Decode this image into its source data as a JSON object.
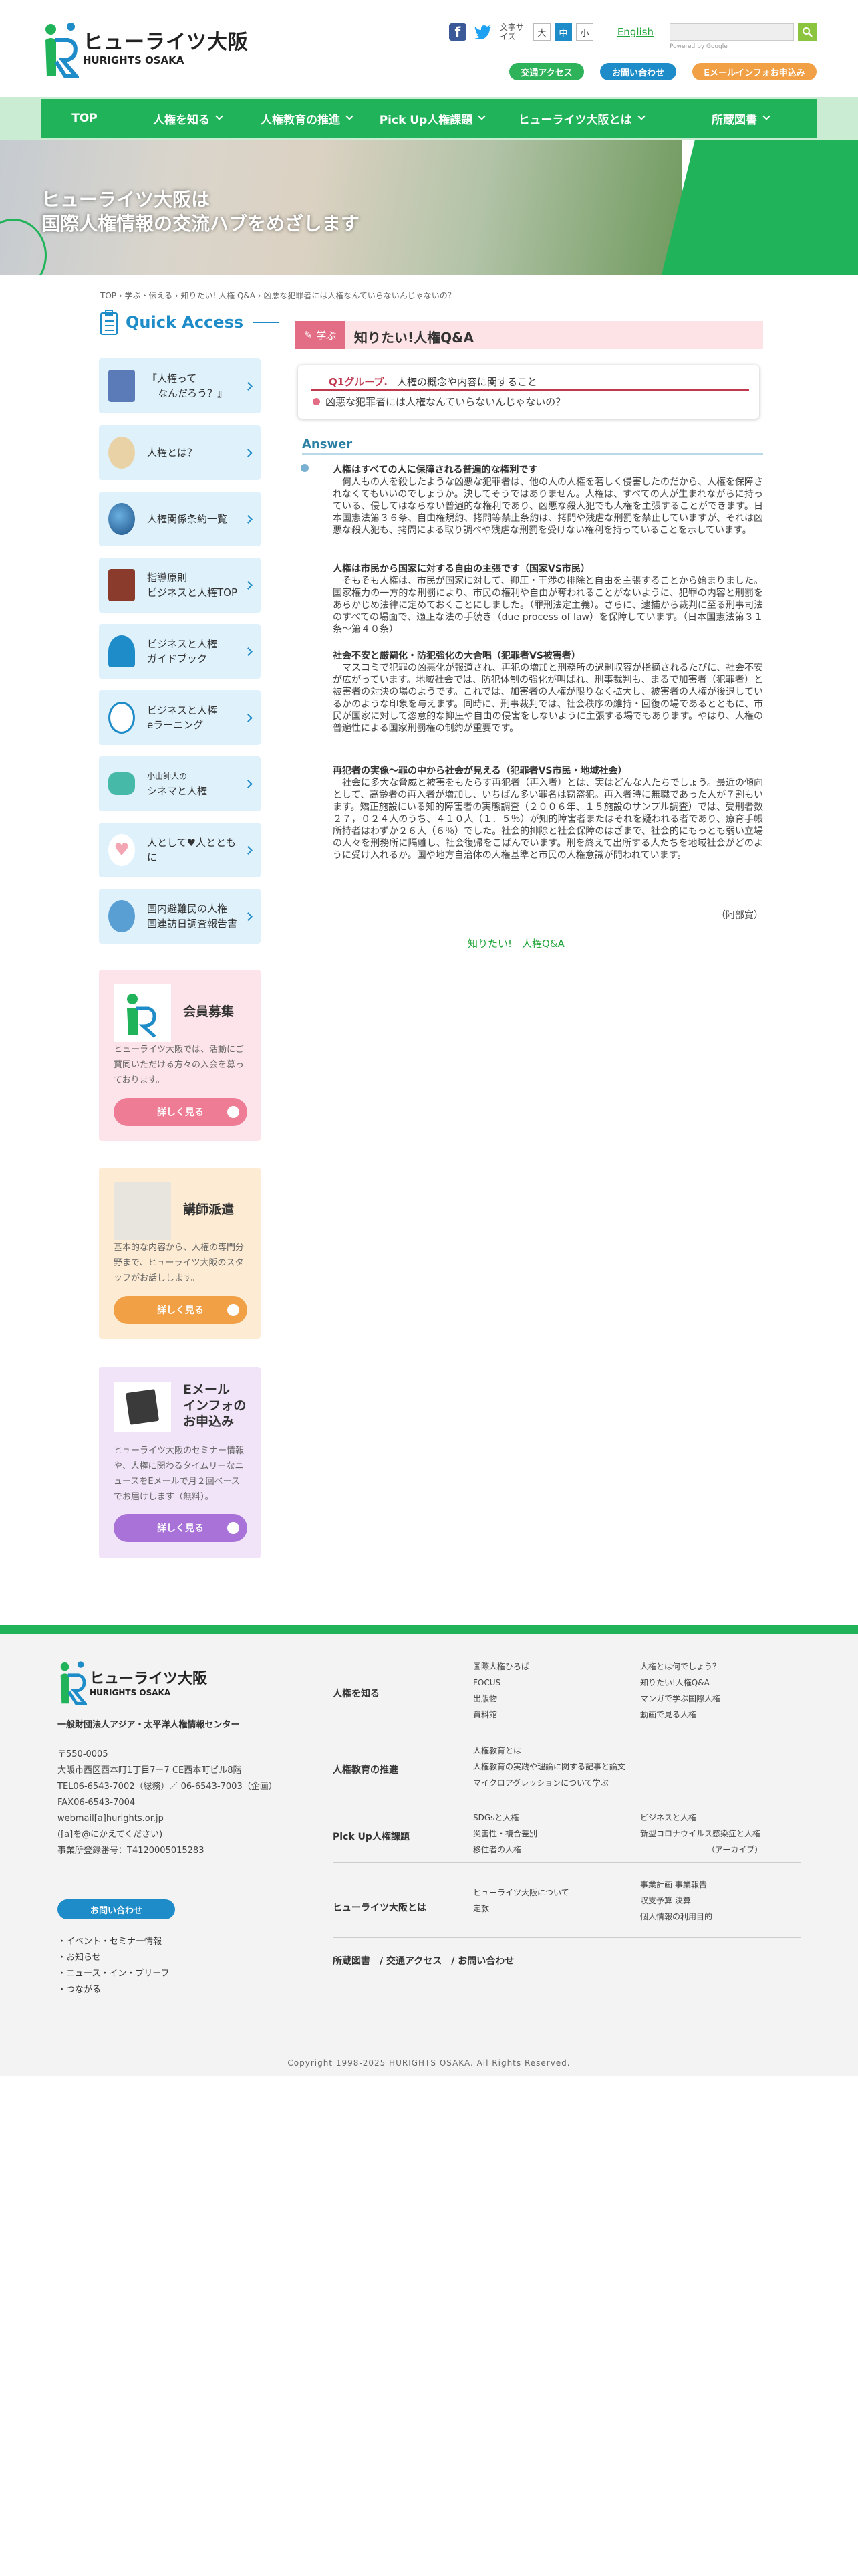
{
  "header": {
    "logo_jp": "ヒューライツ大阪",
    "logo_en": "HURIGHTS OSAKA",
    "font_size_label": "文字サイズ",
    "font_sizes": [
      "大",
      "中",
      "小"
    ],
    "english_link": "English",
    "search_powered": "Powered by Google",
    "buttons": {
      "access": "交通アクセス",
      "contact": "お問い合わせ",
      "emag": "Eメールインフォお申込み"
    }
  },
  "nav": {
    "items": [
      {
        "label": "TOP",
        "has_chevron": false
      },
      {
        "label": "人権を知る",
        "has_chevron": true
      },
      {
        "label": "人権教育の推進",
        "has_chevron": true
      },
      {
        "label": "Pick Up人権課題",
        "has_chevron": true
      },
      {
        "label": "ヒューライツ大阪とは",
        "has_chevron": true
      },
      {
        "label": "所蔵図書",
        "has_chevron": true
      }
    ]
  },
  "hero": {
    "line1": "ヒューライツ大阪は",
    "line2": "国際人権情報の交流ハブをめざします"
  },
  "breadcrumb": "TOP › 学ぶ・伝える › 知りたい! 人権 Q&A › 凶悪な犯罪者には人権なんていらないんじゃないの？",
  "sidebar": {
    "quick_access": "Quick Access",
    "items": [
      {
        "label_1": "『人権って",
        "label_2": "なんだろう？』",
        "icon": "booklet-icon",
        "color": "#5a7ab8"
      },
      {
        "label_1": "人権とは？",
        "label_2": "",
        "icon": "map-icon",
        "color": "#e9d3a6"
      },
      {
        "label_1": "人権関係条約一覧",
        "label_2": "",
        "icon": "globe-icon",
        "color": "#2c6fa6"
      },
      {
        "label_1": "指導原則",
        "label_2": "ビジネスと人権TOP",
        "icon": "book-icon",
        "color": "#8a3b2c"
      },
      {
        "label_1": "ビジネスと人権",
        "label_2": "ガイドブック",
        "icon": "guidebook-icon",
        "color": "#1e8cc8"
      },
      {
        "label_1": "ビジネスと人権",
        "label_2": "eラーニング",
        "icon": "elearning-icon",
        "color": "#1e8cc8"
      },
      {
        "label_1": "小山帥人の",
        "label_2": "シネマと人権",
        "icon": "cinema-icon",
        "color": "#47b9a8"
      },
      {
        "label_1": "人として♥人とともに",
        "label_2": "",
        "icon": "heart-icon",
        "color": "#f2a6b4"
      },
      {
        "label_1": "国内避難民の人権",
        "label_2": "国連訪日調査報告書",
        "icon": "un-icon",
        "color": "#5a9fd4"
      }
    ],
    "promos": {
      "member": {
        "title": "会員募集",
        "desc": "ヒューライツ大阪では、活動にご賛同いただける方々の入会を募っております。",
        "button": "詳しく見る"
      },
      "lecturer": {
        "title": "講師派遣",
        "desc": "基本的な内容から、人権の専門分野まで、ヒューライツ大阪のスタッフがお話しします。",
        "button": "詳しく見る"
      },
      "email": {
        "title_1": "Eメール",
        "title_2": "インフォの",
        "title_3": "お申込み",
        "desc": "ヒューライツ大阪のセミナー情報や、人権に関わるタイムリーなニュースをEメールで月２回ベースでお届けします（無料）。",
        "button": "詳しく見る"
      }
    }
  },
  "main": {
    "tag": "学ぶ",
    "page_title": "知りたい!人権Q&A",
    "q_group_label": "Q1グループ.",
    "q_group_title": "人権の概念や内容に関すること",
    "question": "凶悪な犯罪者には人権なんていらないんじゃないの？",
    "answer_label": "Answer",
    "sections": [
      {
        "heading": "人権はすべての人に保障される普遍的な権利です",
        "text": "何人もの人を殺したような凶悪な犯罪者は、他の人の人権を著しく侵害したのだから、人権を保障されなくてもいいのでしょうか。決してそうではありません。人権は、すべての人が生まれながらに持っている、侵してはならない普遍的な権利であり、凶悪な殺人犯でも人権を主張することができます。日本国憲法第３６条、自由権規約、拷問等禁止条約は、拷問や残虐な刑罰を禁止していますが、それは凶悪な殺人犯も、拷問による取り調べや残虐な刑罰を受けない権利を持っていることを示しています。"
      },
      {
        "heading": "人権は市民から国家に対する自由の主張です（国家VS市民）",
        "text": "そもそも人権は、市民が国家に対して、抑圧・干渉の排除と自由を主張することから始まりました。国家権力の一方的な刑罰により、市民の権利や自由が奪われることがないように、犯罪の内容と刑罰をあらかじめ法律に定めておくことにしました。（罪刑法定主義）。さらに、逮捕から裁判に至る刑事司法のすべての場面で、適正な法の手続き（due process of law）を保障しています。（日本国憲法第３１条～第４０条）"
      },
      {
        "heading": "社会不安と厳罰化・防犯強化の大合唱（犯罪者VS被害者）",
        "text": "マスコミで犯罪の凶悪化が報道され、再犯の増加と刑務所の過剰収容が指摘されるたびに、社会不安が広がっています。地域社会では、防犯体制の強化が叫ばれ、刑事裁判も、まるで加害者（犯罪者）と被害者の対決の場のようです。これでは、加害者の人権が限りなく拡大し、被害者の人権が後退しているかのような印象を与えます。同時に、刑事裁判では、社会秩序の維持・回復の場であるとともに、市民が国家に対して恣意的な抑圧や自由の侵害をしないように主張する場でもあります。やはり、人権の普遍性による国家刑罰権の制約が重要です。"
      },
      {
        "heading": "再犯者の実像～罪の中から社会が見える（犯罪者VS市民・地域社会）",
        "text": "社会に多大な脅威と被害をもたらす再犯者（再入者）とは、実はどんな人たちでしょう。最近の傾向として、高齢者の再入者が増加し、いちばん多い罪名は窃盗犯。再入者時に無職であった人が７割もいます。矯正施設にいる知的障害者の実態調査（２００６年、１５施設のサンプル調査）では、受刑者数２７，０２４人のうち、４１０人（１．５％）が知的障害者またはそれを疑われる者であり、療育手帳所持者はわずか２６人（６％）でした。社会的排除と社会保障のはざまで、社会的にもっとも弱い立場の人々を刑務所に隔離し、社会復帰をこばんでいます。刑を終えて出所する人たちを地域社会がどのように受け入れるか。国や地方自治体の人権基準と市民の人権意識が問われています。"
      }
    ],
    "signature": "（阿部寛）",
    "back_link": "知りたい!　人権Q&A"
  },
  "footer": {
    "logo_jp": "ヒューライツ大阪",
    "logo_en": "HURIGHTS OSAKA",
    "org": "一般財団法人アジア・太平洋人権情報センター",
    "address_lines": [
      "〒550-0005",
      "大阪市西区西本町1丁目7－7 CE西本町ビル8階",
      "TEL06-6543-7002（総務）／ 06-6543-7003（企画）",
      "FAX06-6543-7004",
      "webmail[a]hurights.or.jp",
      "([a]を@にかえてください)",
      "事業所登録番号：T4120005015283"
    ],
    "contact_button": "お問い合わせ",
    "links": [
      "・イベント・セミナー情報",
      "・お知らせ",
      "・ニュース・イン・ブリーフ",
      "・つながる"
    ],
    "rows": [
      {
        "title": "人権を知る",
        "col1": [
          "国際人権ひろば",
          "FOCUS",
          "出版物",
          "資料館"
        ],
        "col2": [
          "人権とは何でしょう？",
          "知りたい!人権Q&A",
          "マンガで学ぶ国際人権",
          "動画で見る人権"
        ]
      },
      {
        "title": "人権教育の推進",
        "col1": [
          "人権教育とは",
          "人権教育の実践や理論に関する記事と論文",
          "マイクロアグレッションについて学ぶ"
        ],
        "col2": []
      },
      {
        "title": "Pick Up人権課題",
        "col1": [
          "SDGsと人権",
          "災害性・複合差別",
          "移住者の人権"
        ],
        "col2": [
          "ビジネスと人権",
          "新型コロナウイルス感染症と人権",
          "（アーカイブ）"
        ]
      },
      {
        "title": "ヒューライツ大阪とは",
        "col1": [
          "ヒューライツ大阪について",
          "定款"
        ],
        "col2": [
          "事業計画 事業報告",
          "収支予算 決算",
          "個人情報の利用目的"
        ]
      }
    ],
    "bottom_links": "所蔵図書　/ 交通アクセス　/ お問い合わせ",
    "copyright": "Copyright 1998-2025 HURIGHTS OSAKA. All Rights Reserved."
  },
  "colors": {
    "brand_green": "#21b35a",
    "accent_blue": "#1e8cc8",
    "pink": "#e46d86",
    "orange": "#f1a046",
    "purple": "#a872d8"
  }
}
